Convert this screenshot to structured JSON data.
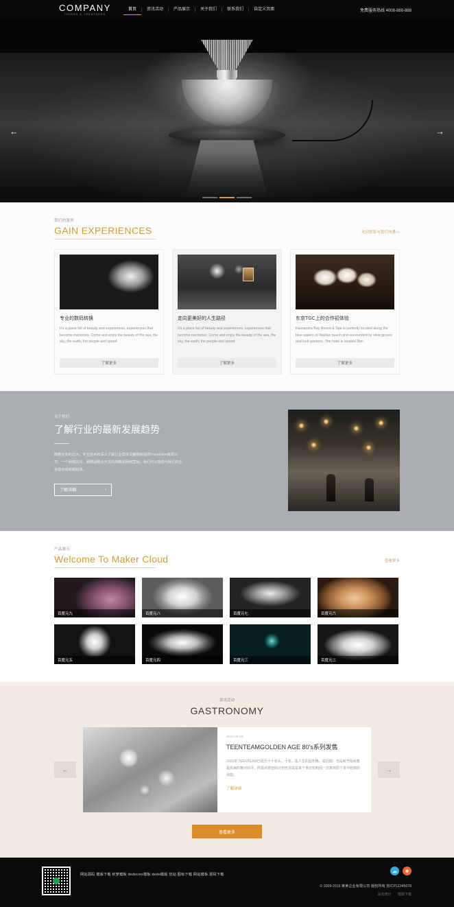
{
  "header": {
    "logo": "COMPANY",
    "logo_sub": "THINGS & TREATURES",
    "nav": [
      {
        "label": "首页",
        "active": true
      },
      {
        "label": "资讯活动",
        "active": false
      },
      {
        "label": "产品展示",
        "active": false
      },
      {
        "label": "关于我们",
        "active": false
      },
      {
        "label": "联系我们",
        "active": false
      },
      {
        "label": "自定义页面",
        "active": false
      }
    ],
    "hotline": "免费服务热线 4008-888-888"
  },
  "hero": {
    "prev_icon": "arrow-left-icon",
    "next_icon": "arrow-right-icon",
    "prev_glyph": "←",
    "next_glyph": "→",
    "slides": 3,
    "active_slide": 2
  },
  "experiences": {
    "kicker": "我们的服务",
    "title": "GAIN EXPERIENCES",
    "more": "欢迎联系与我们沟通>>",
    "cards": [
      {
        "title": "专业的数码转换",
        "body": "It's a place full of beauty and experiences, experiences that become memories. Come and enjoy the beauty of the sea, the sky, the earth, the people and spend",
        "button": "了解更多"
      },
      {
        "title": "走向更美好的人生路径",
        "body": "It's a place full of beauty and experiences, experiences that become memories. Come and enjoy the beauty of the sea, the sky, the earth, the people and spend",
        "button": "了解更多"
      },
      {
        "title": "东京TGC上的合作初体验",
        "body": "Kassandra Bay Resort & Spa is perfectly located along the blue waters of Vasilias beach and surrounded by olive groves and lush gardens. The hotel is located 3km",
        "button": "了解更多"
      }
    ]
  },
  "about": {
    "kicker": "关于我们",
    "title": "了解行业的最新发展趋势",
    "text": "随着业务的壮大，专业技术和深入了解行业需求及策略和提供Proudction有限公司，一个网络的内，网络战略合开发的战略和网络营销，我们可以帮你与我们的企业总合成商额起源。",
    "button": "了解详细",
    "button_icon": "chevron-right-icon",
    "button_glyph": "›"
  },
  "products": {
    "kicker": "产品展示",
    "title": "Welcome To Maker Cloud",
    "more": "查看更多",
    "items": [
      {
        "label": "百度元九"
      },
      {
        "label": "百度元八"
      },
      {
        "label": "百度元七"
      },
      {
        "label": "百度元六"
      },
      {
        "label": "百度元五"
      },
      {
        "label": "百度元四"
      },
      {
        "label": "百度元三"
      },
      {
        "label": "百度元二"
      }
    ]
  },
  "news": {
    "kicker": "资讯活动",
    "title": "GASTRONOMY",
    "prev_glyph": "←",
    "next_glyph": "→",
    "item": {
      "date": "2015-09-18",
      "title": "TEENTEAMGOLDEN AGE 80's系列发售",
      "body": "2015年 TEENTEAM已经历十十年头，十年，是人生的回年精。是回题！也是新开始就像是抗病的某对好评，所需点意但的计划无完是是来个世比较和回一次复到原个本不经典的法能。",
      "more": "了解详细"
    },
    "button": "查看更多"
  },
  "footer": {
    "qr_icon": "qr-code-icon",
    "links": "网站源码 模版下载 织梦模板 dedecms模板 dede模版 仿站 图标下载 网站模板 源码下载",
    "socials": [
      {
        "name": "qq-icon",
        "glyph": "☁"
      },
      {
        "name": "weibo-icon",
        "glyph": "❀"
      }
    ],
    "copyright": "© 2009-2016 某某企业有限公司 版权所有    苏ICP12345678",
    "sub_left": "站长统计",
    "sub_right": "模版下载"
  }
}
